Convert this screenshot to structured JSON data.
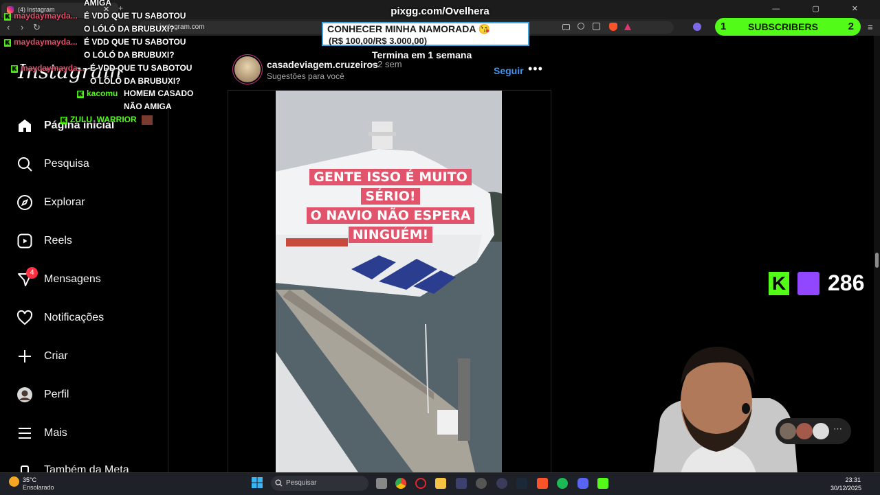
{
  "browser": {
    "tab_title": "(4) Instagram",
    "tab_close": "✕",
    "new_tab": "+",
    "window_controls": "— ▢ ✕",
    "back": "‹",
    "forward": "›",
    "reload": "↻",
    "url": "instagram.com"
  },
  "stream": {
    "url": "pixgg.com/Ovelhera",
    "goal_title": "CONHECER MINHA NAMORADA 😘",
    "goal_progress": "(R$ 100,00/R$ 3.000,00)",
    "goal_progress_fraction": 0.033,
    "goal_deadline": "Termina em 1 semana",
    "subs_left": "1",
    "subs_label": "SUBSCRIBERS",
    "subs_right": "2",
    "viewers": "286"
  },
  "chat": [
    {
      "user": "maydaymayda...",
      "msg": "AMIGA"
    },
    {
      "user": "maydaymayda...",
      "msg": "É VDD QUE TU SABOTOU O LÓLÓ DA BRUBUXI?"
    },
    {
      "user": "maydaymayda...",
      "msg": "É VDD QUE TU SABOTOU O LÓLÓ DA BRUBUXI?"
    },
    {
      "user": "maydaymayda...",
      "msg": "É VDD QUE TU SABOTOU O LÓLÓ DA BRUBUXI?"
    },
    {
      "user": "kacomu",
      "msg": "HOMEM CASADO NÃO AMIGA"
    },
    {
      "user": "ZULU_WARRIOR",
      "msg": ""
    }
  ],
  "instagram": {
    "logo": "Instagram",
    "nav": [
      {
        "label": "Página inicial",
        "icon": "home-icon"
      },
      {
        "label": "Pesquisa",
        "icon": "search-icon"
      },
      {
        "label": "Explorar",
        "icon": "compass-icon"
      },
      {
        "label": "Reels",
        "icon": "reels-icon"
      },
      {
        "label": "Mensagens",
        "icon": "messenger-icon",
        "badge": "4"
      },
      {
        "label": "Notificações",
        "icon": "heart-icon"
      },
      {
        "label": "Criar",
        "icon": "plus-icon"
      },
      {
        "label": "Perfil",
        "icon": "avatar-icon"
      },
      {
        "label": "Mais",
        "icon": "menu-icon"
      },
      {
        "label": "Também da Meta",
        "icon": "meta-icon"
      }
    ],
    "post": {
      "username": "casadeviagem.cruzeiros",
      "time": "• 2 sem",
      "subtitle": "Sugestões para você",
      "follow": "Seguir",
      "more": "•••",
      "caption": [
        "GENTE ISSO É MUITO SÉRIO!",
        "O NAVIO NÃO ESPERA",
        "NINGUÉM!"
      ]
    }
  },
  "taskbar": {
    "temperature": "35°C",
    "weather": "Ensolarado",
    "search": "Pesquisar",
    "time": "23:31",
    "date": "30/12/2025"
  },
  "colors": {
    "ig_link": "#4193ef",
    "kick_green": "#53fc18",
    "caption_bg": "#e2546b",
    "badge_red": "#ff3040"
  }
}
